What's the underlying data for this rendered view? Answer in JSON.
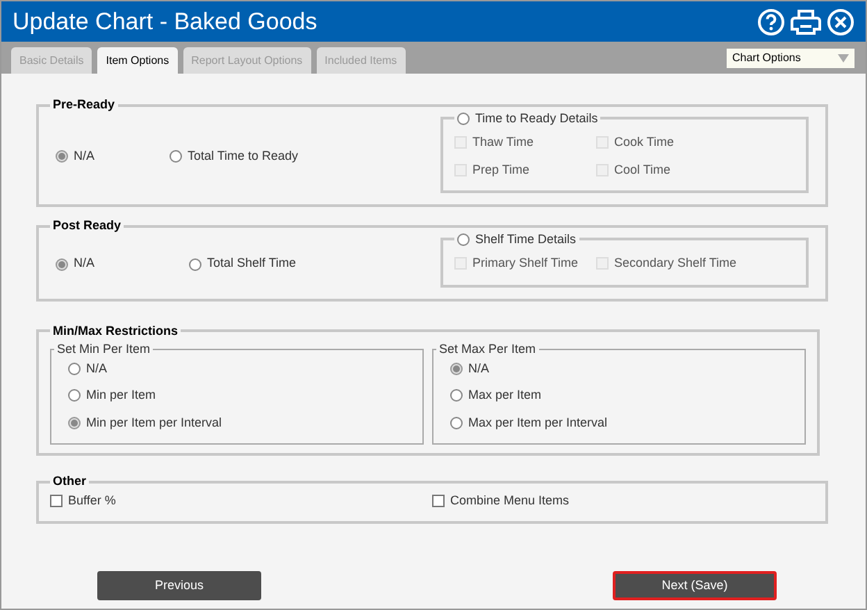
{
  "window": {
    "title": "Update Chart - Baked Goods"
  },
  "tabs": [
    {
      "label": "Basic Details",
      "selected": false
    },
    {
      "label": "Item Options",
      "selected": true
    },
    {
      "label": "Report Layout Options",
      "selected": false
    },
    {
      "label": "Included Items",
      "selected": false
    }
  ],
  "view_select": {
    "value": "Chart Options"
  },
  "pre_ready": {
    "legend": "Pre-Ready",
    "options": [
      {
        "label": "N/A",
        "selected": true
      },
      {
        "label": "Total Time to Ready",
        "selected": false
      }
    ],
    "details": {
      "label": "Time to Ready Details",
      "selected": false,
      "items": [
        {
          "label": "Thaw Time",
          "checked": false,
          "disabled": true
        },
        {
          "label": "Cook Time",
          "checked": false,
          "disabled": true
        },
        {
          "label": "Prep Time",
          "checked": false,
          "disabled": true
        },
        {
          "label": "Cool Time",
          "checked": false,
          "disabled": true
        }
      ]
    }
  },
  "post_ready": {
    "legend": "Post Ready",
    "options": [
      {
        "label": "N/A",
        "selected": true
      },
      {
        "label": "Total Shelf Time",
        "selected": false
      }
    ],
    "details": {
      "label": "Shelf Time Details",
      "selected": false,
      "items": [
        {
          "label": "Primary Shelf Time",
          "checked": false,
          "disabled": true
        },
        {
          "label": "Secondary Shelf Time",
          "checked": false,
          "disabled": true
        }
      ]
    }
  },
  "min_max": {
    "legend": "Min/Max Restrictions",
    "groups": [
      {
        "legend": "Set Min Per Item",
        "options": [
          {
            "label": "N/A",
            "selected": false
          },
          {
            "label": "Min per Item",
            "selected": false
          },
          {
            "label": "Min per Item per Interval",
            "selected": true
          }
        ]
      },
      {
        "legend": "Set Max Per Item",
        "options": [
          {
            "label": "N/A",
            "selected": true
          },
          {
            "label": "Max per Item",
            "selected": false
          },
          {
            "label": "Max per Item per Interval",
            "selected": false
          }
        ]
      }
    ]
  },
  "other": {
    "legend": "Other",
    "items": [
      {
        "label": "Buffer %",
        "checked": false,
        "disabled": false
      },
      {
        "label": "Combine Menu Items",
        "checked": false,
        "disabled": false
      }
    ]
  },
  "buttons": [
    {
      "label": "Previous",
      "focused": false
    },
    {
      "label": "Next (Save)",
      "focused": true
    }
  ]
}
